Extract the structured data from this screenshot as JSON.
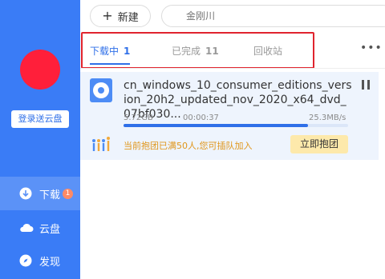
{
  "sidebar": {
    "login_label": "登录送云盘",
    "nav": [
      {
        "label": "下载",
        "icon": "download-icon",
        "badge": "1"
      },
      {
        "label": "云盘",
        "icon": "cloud-icon"
      },
      {
        "label": "发现",
        "icon": "compass-icon"
      }
    ]
  },
  "toolbar": {
    "new_label": "新建",
    "search_placeholder": "金刚川"
  },
  "tabs": [
    {
      "label": "下载中",
      "count": "1"
    },
    {
      "label": "已完成",
      "count": "11"
    },
    {
      "label": "回收站",
      "count": ""
    }
  ],
  "more_label": "•••",
  "download": {
    "filename": "cn_windows_10_consumer_editions_version_20h2_updated_nov_2020_x64_dvd_07bf030...",
    "size": "5.72GB",
    "time_left": "00:00:37",
    "speed": "25.3MB/s",
    "progress": 0.82,
    "group_text": "当前抱团已满50人,您可插队加入",
    "join_label": "立即抱团"
  },
  "colors": {
    "sidebar_bg": "#3a7cf6",
    "accent": "#2f6fe8",
    "avatar": "#ff1f3a",
    "highlight_border": "#e0242e",
    "group_text": "#e0961a",
    "join_bg": "#fde9ab"
  }
}
